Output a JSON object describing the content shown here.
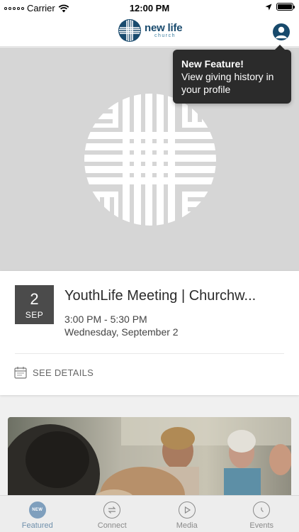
{
  "status_bar": {
    "carrier": "Carrier",
    "time": "12:00 PM",
    "icons": [
      "signal-dots",
      "wifi-icon",
      "location-arrow-icon",
      "battery-icon"
    ]
  },
  "header": {
    "logo_main": "new life",
    "logo_sub": "church",
    "brand_color": "#1a4b6e",
    "profile_icon": "user-profile-icon"
  },
  "tooltip": {
    "title": "New Feature!",
    "body": "View giving history in your profile"
  },
  "event": {
    "day": "2",
    "month": "SEP",
    "title": "YouthLife Meeting | Churchw...",
    "time": "3:00 PM - 5:30 PM",
    "date": "Wednesday, September 2",
    "details_label": "SEE DETAILS"
  },
  "tabs": [
    {
      "label": "Featured",
      "icon": "new-badge-icon",
      "badge": "NEW",
      "active": true
    },
    {
      "label": "Connect",
      "icon": "connect-arrows-icon",
      "active": false
    },
    {
      "label": "Media",
      "icon": "play-icon",
      "active": false
    },
    {
      "label": "Events",
      "icon": "clock-icon",
      "active": false
    }
  ],
  "colors": {
    "accent": "#7f9fbd",
    "tooltip_bg": "#2b2b2b",
    "hero_bg": "#d6d6d6",
    "date_badge_bg": "#4b4b4b"
  }
}
